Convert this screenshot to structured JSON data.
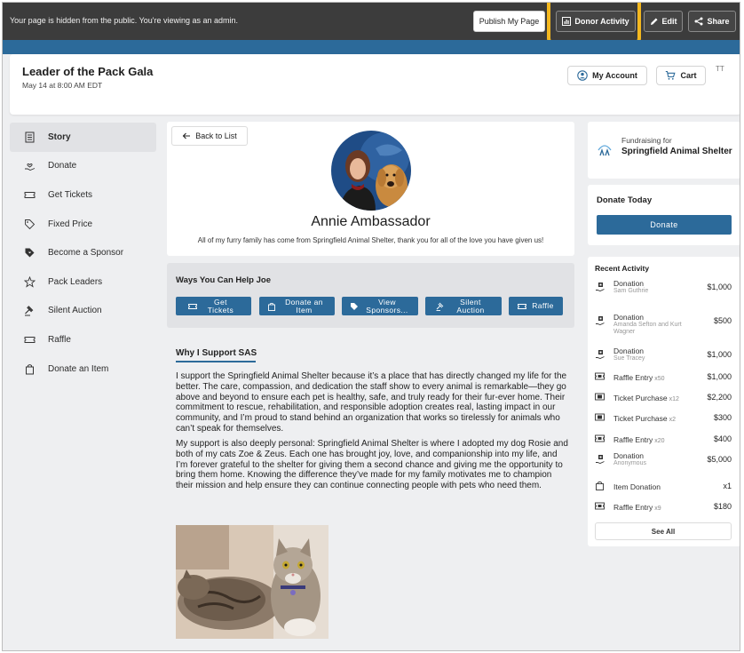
{
  "admin_bar": {
    "message": "Your page is hidden from the public. You're viewing as an admin.",
    "publish_label": "Publish My Page",
    "donor_activity_label": "Donor Activity",
    "edit_label": "Edit",
    "share_label": "Share"
  },
  "event": {
    "title": "Leader of the Pack Gala",
    "date": "May 14 at 8:00 AM EDT",
    "my_account_label": "My Account",
    "cart_label": "Cart",
    "text_size_icon": "TT"
  },
  "sidebar": {
    "items": [
      {
        "label": "Story",
        "icon": "book-icon",
        "active": true
      },
      {
        "label": "Donate",
        "icon": "hand-heart-icon",
        "active": false
      },
      {
        "label": "Get Tickets",
        "icon": "ticket-icon",
        "active": false
      },
      {
        "label": "Fixed Price",
        "icon": "tag-icon",
        "active": false
      },
      {
        "label": "Become a Sponsor",
        "icon": "sponsor-tag-icon",
        "active": false
      },
      {
        "label": "Pack Leaders",
        "icon": "star-icon",
        "active": false
      },
      {
        "label": "Silent Auction",
        "icon": "gavel-icon",
        "active": false
      },
      {
        "label": "Raffle",
        "icon": "ticket-icon",
        "active": false
      },
      {
        "label": "Donate an Item",
        "icon": "bag-icon",
        "active": false
      }
    ]
  },
  "profile": {
    "back_label": "Back to List",
    "name": "Annie Ambassador",
    "tagline": "All of my furry family has come from Springfield Animal Shelter, thank you for all of the love you have given us!"
  },
  "ways": {
    "title": "Ways You Can Help Joe",
    "buttons": [
      {
        "label": "Get Tickets",
        "icon": "ticket-icon"
      },
      {
        "label": "Donate an Item",
        "icon": "bag-icon"
      },
      {
        "label": "View Sponsors...",
        "icon": "sponsor-tag-icon"
      },
      {
        "label": "Silent Auction",
        "icon": "gavel-icon"
      },
      {
        "label": "Raffle",
        "icon": "ticket-icon"
      }
    ]
  },
  "story": {
    "heading": "Why I Support SAS",
    "paragraphs": [
      "I support the Springfield Animal Shelter because it’s a place that has directly changed my life for the better. The care, compassion, and dedication the staff show to every animal is remarkable—they go above and beyond to ensure each pet is healthy, safe, and truly ready for their fur-ever home. Their commitment to rescue, rehabilitation, and responsible adoption creates real, lasting impact in our community, and I’m proud to stand behind an organization that works so tirelessly for animals who can’t speak for themselves.",
      "My support is also deeply personal: Springfield Animal Shelter is where I adopted my dog Rosie and both of my cats Zoe & Zeus. Each one has brought joy, love, and companionship into my life, and I’m forever grateful to the shelter for giving them a second chance and giving me the opportunity to bring them home. Knowing the difference they’ve made for my family motivates me to champion their mission and help ensure they can continue connecting people with pets who need them."
    ]
  },
  "fundraising": {
    "label": "Fundraising for",
    "org": "Springfield Animal Shelter"
  },
  "donate_today": {
    "title": "Donate Today",
    "button_label": "Donate"
  },
  "recent_activity": {
    "title": "Recent Activity",
    "see_all_label": "See All",
    "items": [
      {
        "type": "Donation",
        "qty": "",
        "sub": "Sam Guthrie",
        "amount": "$1,000",
        "icon": "donation-icon"
      },
      {
        "type": "Donation",
        "qty": "",
        "sub": "Amanda Sefton and Kurt Wagner",
        "amount": "$500",
        "icon": "donation-icon"
      },
      {
        "type": "Donation",
        "qty": "",
        "sub": "Sue Tracey",
        "amount": "$1,000",
        "icon": "donation-icon"
      },
      {
        "type": "Raffle Entry",
        "qty": "x50",
        "sub": "",
        "amount": "$1,000",
        "icon": "raffle-ticket-icon"
      },
      {
        "type": "Ticket Purchase",
        "qty": "x12",
        "sub": "",
        "amount": "$2,200",
        "icon": "ticket-icon"
      },
      {
        "type": "Ticket Purchase",
        "qty": "x2",
        "sub": "",
        "amount": "$300",
        "icon": "ticket-icon"
      },
      {
        "type": "Raffle Entry",
        "qty": "x20",
        "sub": "",
        "amount": "$400",
        "icon": "raffle-ticket-icon"
      },
      {
        "type": "Donation",
        "qty": "",
        "sub": "Anonymous",
        "amount": "$5,000",
        "icon": "donation-icon"
      },
      {
        "type": "Item Donation",
        "qty": "",
        "sub": "",
        "amount": "x1",
        "icon": "bag-icon"
      },
      {
        "type": "Raffle Entry",
        "qty": "x9",
        "sub": "",
        "amount": "$180",
        "icon": "raffle-ticket-icon"
      }
    ]
  },
  "colors": {
    "primary": "#2c6a9a",
    "admin_bar": "#3c3c3c",
    "highlight": "#f4b81f"
  }
}
